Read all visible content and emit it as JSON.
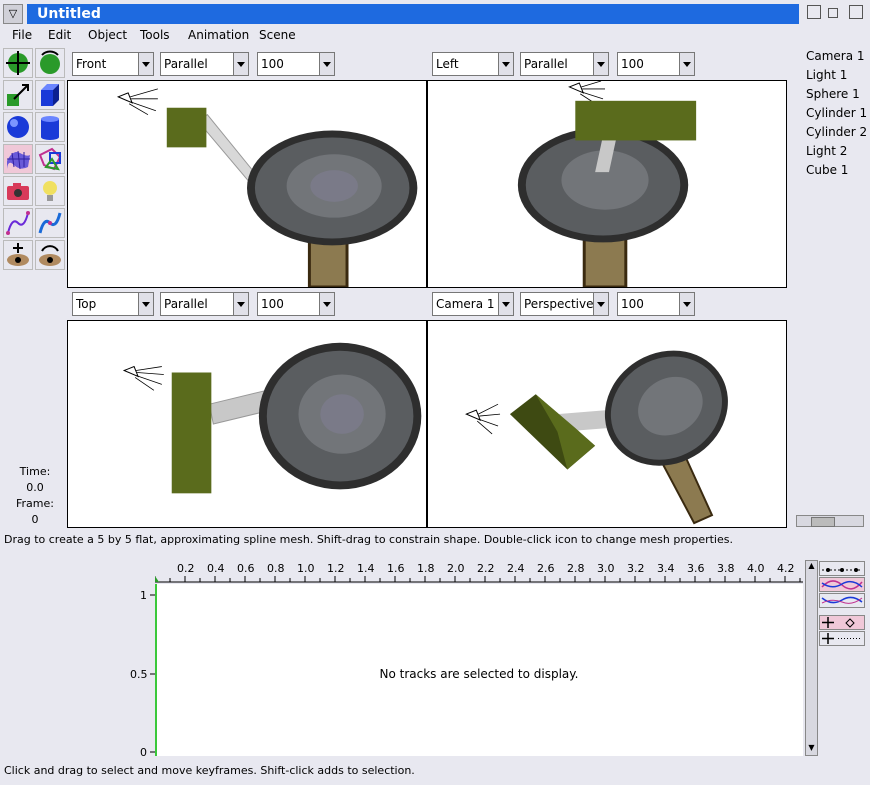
{
  "window": {
    "title": "Untitled"
  },
  "menu": [
    "File",
    "Edit",
    "Object",
    "Tools",
    "Animation",
    "Scene"
  ],
  "viewports": [
    {
      "view": "Front",
      "projection": "Parallel",
      "zoom": "100"
    },
    {
      "view": "Left",
      "projection": "Parallel",
      "zoom": "100"
    },
    {
      "view": "Top",
      "projection": "Parallel",
      "zoom": "100"
    },
    {
      "view": "Camera 1",
      "projection": "Perspective",
      "zoom": "100"
    }
  ],
  "objects": [
    "Camera 1",
    "Light 1",
    "Sphere 1",
    "Cylinder 1",
    "Cylinder 2",
    "Light 2",
    "Cube 1"
  ],
  "time": {
    "time_label": "Time:",
    "time_value": "0.0",
    "frame_label": "Frame:",
    "frame_value": "0"
  },
  "status": {
    "tool_hint": "Drag to create a 5 by 5 flat, approximating spline mesh.  Shift-drag to constrain shape.  Double-click icon to change mesh properties.",
    "score_hint": "Click and drag to select and move keyframes.  Shift-click adds to selection."
  },
  "score": {
    "ruler_ticks": [
      "0.2",
      "0.4",
      "0.6",
      "0.8",
      "1.0",
      "1.2",
      "1.4",
      "1.6",
      "1.8",
      "2.0",
      "2.2",
      "2.4",
      "2.6",
      "2.8",
      "3.0",
      "3.2",
      "3.4",
      "3.6",
      "3.8",
      "4.0",
      "4.2"
    ],
    "y_ticks": [
      "1",
      "0.5",
      "0"
    ],
    "empty_message": "No tracks are selected to display."
  },
  "colors": {
    "title_bar": "#1e6ae0",
    "selected_tool": "#f0c8d8",
    "cube": "#5a6b1c",
    "sphere": "#5a5d60",
    "cylinder": "#8c7a50"
  },
  "tools": [
    "move-icon",
    "rotate-icon",
    "resize-icon",
    "cube-icon",
    "sphere-icon",
    "cylinder-icon",
    "spline-mesh-icon",
    "polygon-icon",
    "camera-icon",
    "light-bulb-icon",
    "curve-icon",
    "tube-icon",
    "move-view-icon",
    "rotate-view-icon"
  ]
}
